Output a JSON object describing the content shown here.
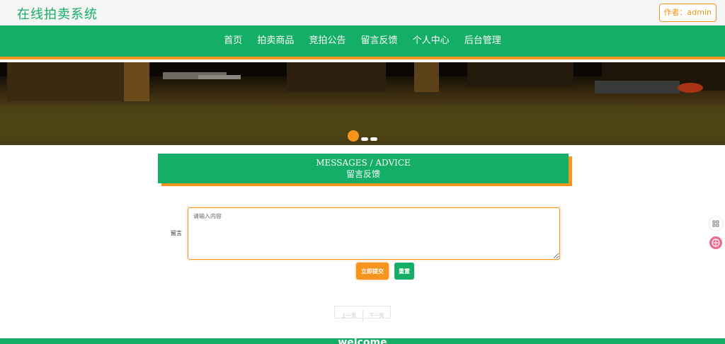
{
  "header": {
    "site_title": "在线拍卖系统",
    "author_label": "作者：admin"
  },
  "nav": {
    "items": [
      {
        "label": "首页"
      },
      {
        "label": "拍卖商品"
      },
      {
        "label": "竞拍公告"
      },
      {
        "label": "留言反馈"
      },
      {
        "label": "个人中心"
      },
      {
        "label": "后台管理"
      }
    ]
  },
  "carousel": {
    "slide_count": 3,
    "active_index": 0
  },
  "section": {
    "title_en": "MESSAGES / ADVICE",
    "title_cn": "留言反馈"
  },
  "form": {
    "label": "留言",
    "placeholder": "请输入内容",
    "submit_label": "立即提交",
    "reset_label": "重置"
  },
  "pagination": {
    "prev": "上一页",
    "next": "下一页"
  },
  "footer": {
    "text": "welcome"
  },
  "colors": {
    "primary": "#14ae67",
    "accent": "#f7941d"
  },
  "icons": {
    "float_top": "apps-icon",
    "float_bottom": "language-icon"
  }
}
